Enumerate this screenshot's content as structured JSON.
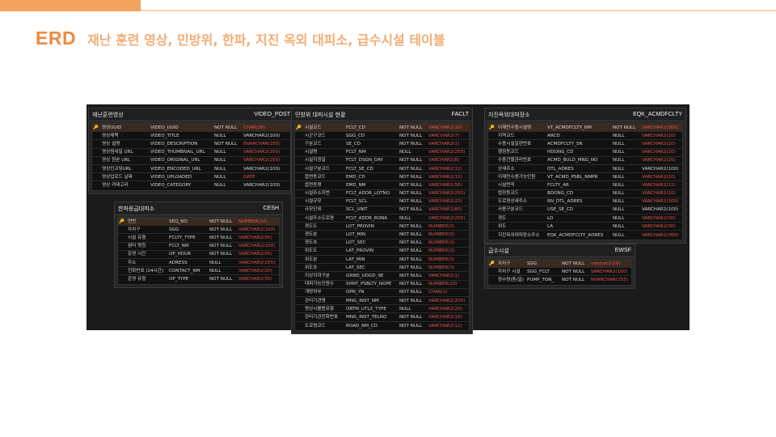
{
  "header": {
    "prefix": "ERD",
    "title": "재난 훈련 영상, 민방위, 한파, 지진 옥외 대피소, 급수시설 테이블"
  },
  "icons": {
    "primary_key": "key-icon"
  },
  "colors": {
    "accent": "#ee8a3f",
    "canvas": "#1b1b1b",
    "pk_row": "#3a2a20",
    "type_highlight": "#e2524a"
  },
  "tables": [
    {
      "label": "재난훈련영상",
      "physical": "VIDEO_POST",
      "columns": [
        {
          "logical": "영상UUID",
          "physical": "VIDEO_UUID",
          "nullable": "NOT NULL",
          "type": "CHAR(36)",
          "pk": true,
          "highlight": true
        },
        {
          "logical": "영상제목",
          "physical": "VIDEO_TITLE",
          "nullable": "NULL",
          "type": "VARCHAR2(100)",
          "pk": false,
          "highlight": false
        },
        {
          "logical": "영상 설명",
          "physical": "VIDEO_DESCRIPTION",
          "nullable": "NOT NULL",
          "type": "NVARCHAR(255)",
          "pk": false,
          "highlight": true
        },
        {
          "logical": "영상썸네일 URL",
          "physical": "VIDEO_THUMBNAIL_URL",
          "nullable": "NULL",
          "type": "VARCHAR2(255)",
          "pk": false,
          "highlight": true
        },
        {
          "logical": "영상 원본 URL",
          "physical": "VIDEO_ORIGINAL_URL",
          "nullable": "NULL",
          "type": "VARCHAR2(255)",
          "pk": false,
          "highlight": true
        },
        {
          "logical": "영상인코딩URL",
          "physical": "VIDEO_ENCODED_URL",
          "nullable": "NULL",
          "type": "VARCHAR2(100)",
          "pk": false,
          "highlight": false
        },
        {
          "logical": "영상업로드 날짜",
          "physical": "VIDEO_UPLOADED",
          "nullable": "NULL",
          "type": "DATE",
          "pk": false,
          "highlight": true
        },
        {
          "logical": "영상 카테고리",
          "physical": "VIDEO_CATEGORY",
          "nullable": "NULL",
          "type": "VARCHAR2(100)",
          "pk": false,
          "highlight": false
        }
      ]
    },
    {
      "label": "한파응급대피소",
      "physical": "CESH",
      "columns": [
        {
          "logical": "연번",
          "physical": "SEQ_NO",
          "nullable": "NOT NULL",
          "type": "NUMBER(10)",
          "pk": true,
          "highlight": true
        },
        {
          "logical": "자치구",
          "physical": "SGG",
          "nullable": "NOT NULL",
          "type": "VARCHAR2(100)",
          "pk": false,
          "highlight": true
        },
        {
          "logical": "시설 유형",
          "physical": "FCLTY_TYPE",
          "nullable": "NOT NULL",
          "type": "VARCHAR2(50)",
          "pk": false,
          "highlight": true
        },
        {
          "logical": "쉼터 명칭",
          "physical": "FCLT_NM",
          "nullable": "NOT NULL",
          "type": "VARCHAR2(100)",
          "pk": false,
          "highlight": true
        },
        {
          "logical": "운영 시간",
          "physical": "OP_HOUR",
          "nullable": "NOT NULL",
          "type": "VARCHAR2(50)",
          "pk": false,
          "highlight": true
        },
        {
          "logical": "주소",
          "physical": "ADRESS",
          "nullable": "NULL",
          "type": "VARCHAR2(255)",
          "pk": false,
          "highlight": true
        },
        {
          "logical": "전화번호 (24시간)",
          "physical": "CONTACT_NM",
          "nullable": "NULL",
          "type": "VARCHAR2(20)",
          "pk": false,
          "highlight": true
        },
        {
          "logical": "운영 유형",
          "physical": "OP_TYPE",
          "nullable": "NOT NULL",
          "type": "VARCHAR2(50)",
          "pk": false,
          "highlight": true
        }
      ]
    },
    {
      "label": "민방위 대피시설 현황",
      "physical": "FACLT",
      "columns": [
        {
          "logical": "시설코드",
          "physical": "FCLT_CD",
          "nullable": "NOT NULL",
          "type": "VARCHAR2(10)",
          "pk": true,
          "highlight": true
        },
        {
          "logical": "시군구코드",
          "physical": "SGG_CD",
          "nullable": "NOT NULL",
          "type": "VARCHAR2(7)",
          "pk": false,
          "highlight": true
        },
        {
          "logical": "구분코드",
          "physical": "SE_CD",
          "nullable": "NOT NULL",
          "type": "VARCHAR2(1)",
          "pk": false,
          "highlight": true
        },
        {
          "logical": "시설명",
          "physical": "FCLT_NM",
          "nullable": "NULL",
          "type": "VARCHAR2(255)",
          "pk": false,
          "highlight": true
        },
        {
          "logical": "시설지정일",
          "physical": "FCLT_DSGN_DAY",
          "nullable": "NOT NULL",
          "type": "VARCHAR2(8)",
          "pk": false,
          "highlight": true
        },
        {
          "logical": "시설구분코드",
          "physical": "FCLT_SE_CD",
          "nullable": "NOT NULL",
          "type": "VARCHAR2(12)",
          "pk": false,
          "highlight": true
        },
        {
          "logical": "읍면동코드",
          "physical": "EMD_CD",
          "nullable": "NOT NULL",
          "type": "VARCHAR2(12)",
          "pk": false,
          "highlight": true
        },
        {
          "logical": "읍면동명",
          "physical": "EMD_NM",
          "nullable": "NOT NULL",
          "type": "VARCHAR2(50)",
          "pk": false,
          "highlight": true
        },
        {
          "logical": "시설주소지번",
          "physical": "FCLT_ADDR_LOTNO",
          "nullable": "NOT NULL",
          "type": "VARCHAR2(255)",
          "pk": false,
          "highlight": true
        },
        {
          "logical": "시설규모",
          "physical": "FCLT_SCL",
          "nullable": "NOT NULL",
          "type": "VARCHAR2(22)",
          "pk": false,
          "highlight": true
        },
        {
          "logical": "규모단위",
          "physical": "SCL_UNIT",
          "nullable": "NOT NULL",
          "type": "VARCHAR2(80)",
          "pk": false,
          "highlight": true
        },
        {
          "logical": "시설주소도로명",
          "physical": "FCLT_ADDR_RONA",
          "nullable": "NULL",
          "type": "VARCHAR2(255)",
          "pk": false,
          "highlight": true
        },
        {
          "logical": "경도도",
          "physical": "LOT_PROVIN",
          "nullable": "NOT NULL",
          "type": "NUMBER(3)",
          "pk": false,
          "highlight": true
        },
        {
          "logical": "경도분",
          "physical": "LOT_MIN",
          "nullable": "NOT NULL",
          "type": "NUMBER(3)",
          "pk": false,
          "highlight": true
        },
        {
          "logical": "경도초",
          "physical": "LOT_SEC",
          "nullable": "NOT NULL",
          "type": "NUMBER(3)",
          "pk": false,
          "highlight": true
        },
        {
          "logical": "위도도",
          "physical": "LAT_PROVIN",
          "nullable": "NOT NULL",
          "type": "NUMBER(3)",
          "pk": false,
          "highlight": true
        },
        {
          "logical": "위도분",
          "physical": "LAT_MIN",
          "nullable": "NOT NULL",
          "type": "NUMBER(3)",
          "pk": false,
          "highlight": true
        },
        {
          "logical": "위도초",
          "physical": "LAT_SEC",
          "nullable": "NOT NULL",
          "type": "NUMBER(3)",
          "pk": false,
          "highlight": true
        },
        {
          "logical": "지상지하구분",
          "physical": "GRND_UDGD_SE",
          "nullable": "NOT NULL",
          "type": "VARCHAR2(1)",
          "pk": false,
          "highlight": true
        },
        {
          "logical": "대피가능인원수",
          "physical": "SHNT_PSBLTY_NOPE",
          "nullable": "NOT NULL",
          "type": "NUMBER(10)",
          "pk": false,
          "highlight": true
        },
        {
          "logical": "개방여부",
          "physical": "OPN_YN",
          "nullable": "NOT NULL",
          "type": "CHAR(1)",
          "pk": false,
          "highlight": true
        },
        {
          "logical": "관리기관명",
          "physical": "MNG_INST_NM",
          "nullable": "NOT NULL",
          "type": "VARCHAR2(200)",
          "pk": false,
          "highlight": true
        },
        {
          "logical": "평상시활용유형",
          "physical": "ORTM_UTLZ_TYPE",
          "nullable": "NULL",
          "type": "VARCHAR2(20)",
          "pk": false,
          "highlight": true
        },
        {
          "logical": "관리기관전화번호",
          "physical": "MNG_INST_TELNO",
          "nullable": "NOT NULL",
          "type": "VARCHAR2(15)",
          "pk": false,
          "highlight": true
        },
        {
          "logical": "도로명코드",
          "physical": "ROAD_NM_CD",
          "nullable": "NOT NULL",
          "type": "VARCHAR2(12)",
          "pk": false,
          "highlight": true
        }
      ]
    },
    {
      "label": "지진옥외대피장소",
      "physical": "EQK_ACMDFCLTY",
      "columns": [
        {
          "logical": "이재민수용시설명",
          "physical": "VT_ACMDFCLTY_NM",
          "nullable": "NOT NULL",
          "type": "VARCHAR2(300)",
          "pk": true,
          "highlight": true
        },
        {
          "logical": "지역코드",
          "physical": "ARCD",
          "nullable": "NULL",
          "type": "VARCHAR2(10)",
          "pk": false,
          "highlight": true
        },
        {
          "logical": "수용시설일련번호",
          "physical": "ACMDFCLTY_SN",
          "nullable": "NULL",
          "type": "VARCHAR2(10)",
          "pk": false,
          "highlight": true
        },
        {
          "logical": "행정동코드",
          "physical": "HDONG_CD",
          "nullable": "NULL",
          "type": "VARCHAR2(10)",
          "pk": false,
          "highlight": true
        },
        {
          "logical": "수용건물관리번호",
          "physical": "ACMD_BULD_MNG_NO",
          "nullable": "NULL",
          "type": "VARCHAR2(25)",
          "pk": false,
          "highlight": true
        },
        {
          "logical": "상세주소",
          "physical": "DTL_ADRES",
          "nullable": "NULL",
          "type": "VARCHAR2(100)",
          "pk": false,
          "highlight": false
        },
        {
          "logical": "이재민수용가능인원",
          "physical": "VT_ACMD_PSBL_NMPR",
          "nullable": "NULL",
          "type": "VARCHAR2(10)",
          "pk": false,
          "highlight": true
        },
        {
          "logical": "시설면적",
          "physical": "FCLTY_AR",
          "nullable": "NULL",
          "type": "VARCHAR2(12)",
          "pk": false,
          "highlight": true
        },
        {
          "logical": "법정동코드",
          "physical": "BDONG_CD",
          "nullable": "NULL",
          "type": "VARCHAR2(10)",
          "pk": false,
          "highlight": true
        },
        {
          "logical": "도로명상세주소",
          "physical": "RN_DTL_ADRES",
          "nullable": "NULL",
          "type": "VARCHAR2(300)",
          "pk": false,
          "highlight": true
        },
        {
          "logical": "사용구분코드",
          "physical": "USE_SE_CD",
          "nullable": "NULL",
          "type": "VARCHAR2(100)",
          "pk": false,
          "highlight": false
        },
        {
          "logical": "경도",
          "physical": "LO",
          "nullable": "NULL",
          "type": "VARCHAR2(30)",
          "pk": false,
          "highlight": true
        },
        {
          "logical": "위도",
          "physical": "LA",
          "nullable": "NULL",
          "type": "VARCHAR2(30)",
          "pk": false,
          "highlight": true
        },
        {
          "logical": "지진옥외대피장소주소",
          "physical": "EQK_ACMDFCLTY_ADRES",
          "nullable": "NULL",
          "type": "VARCHAR2(300)",
          "pk": false,
          "highlight": true
        }
      ]
    },
    {
      "label": "급수시설",
      "physical": "EWSF",
      "columns": [
        {
          "logical": "자치구",
          "physical": "SGG",
          "nullable": "NOT NULL",
          "type": "varchar2(20)",
          "pk": true,
          "highlight": true
        },
        {
          "logical": "자치구 시설",
          "physical": "SGG_FCLT",
          "nullable": "NOT NULL",
          "type": "VARCHAR2(100)",
          "pk": false,
          "highlight": true
        },
        {
          "logical": "양수량(톤/일)",
          "physical": "PUMP_TON_",
          "nullable": "NOT NULL",
          "type": "NVARCHAR(255)",
          "pk": false,
          "highlight": true
        }
      ]
    }
  ]
}
